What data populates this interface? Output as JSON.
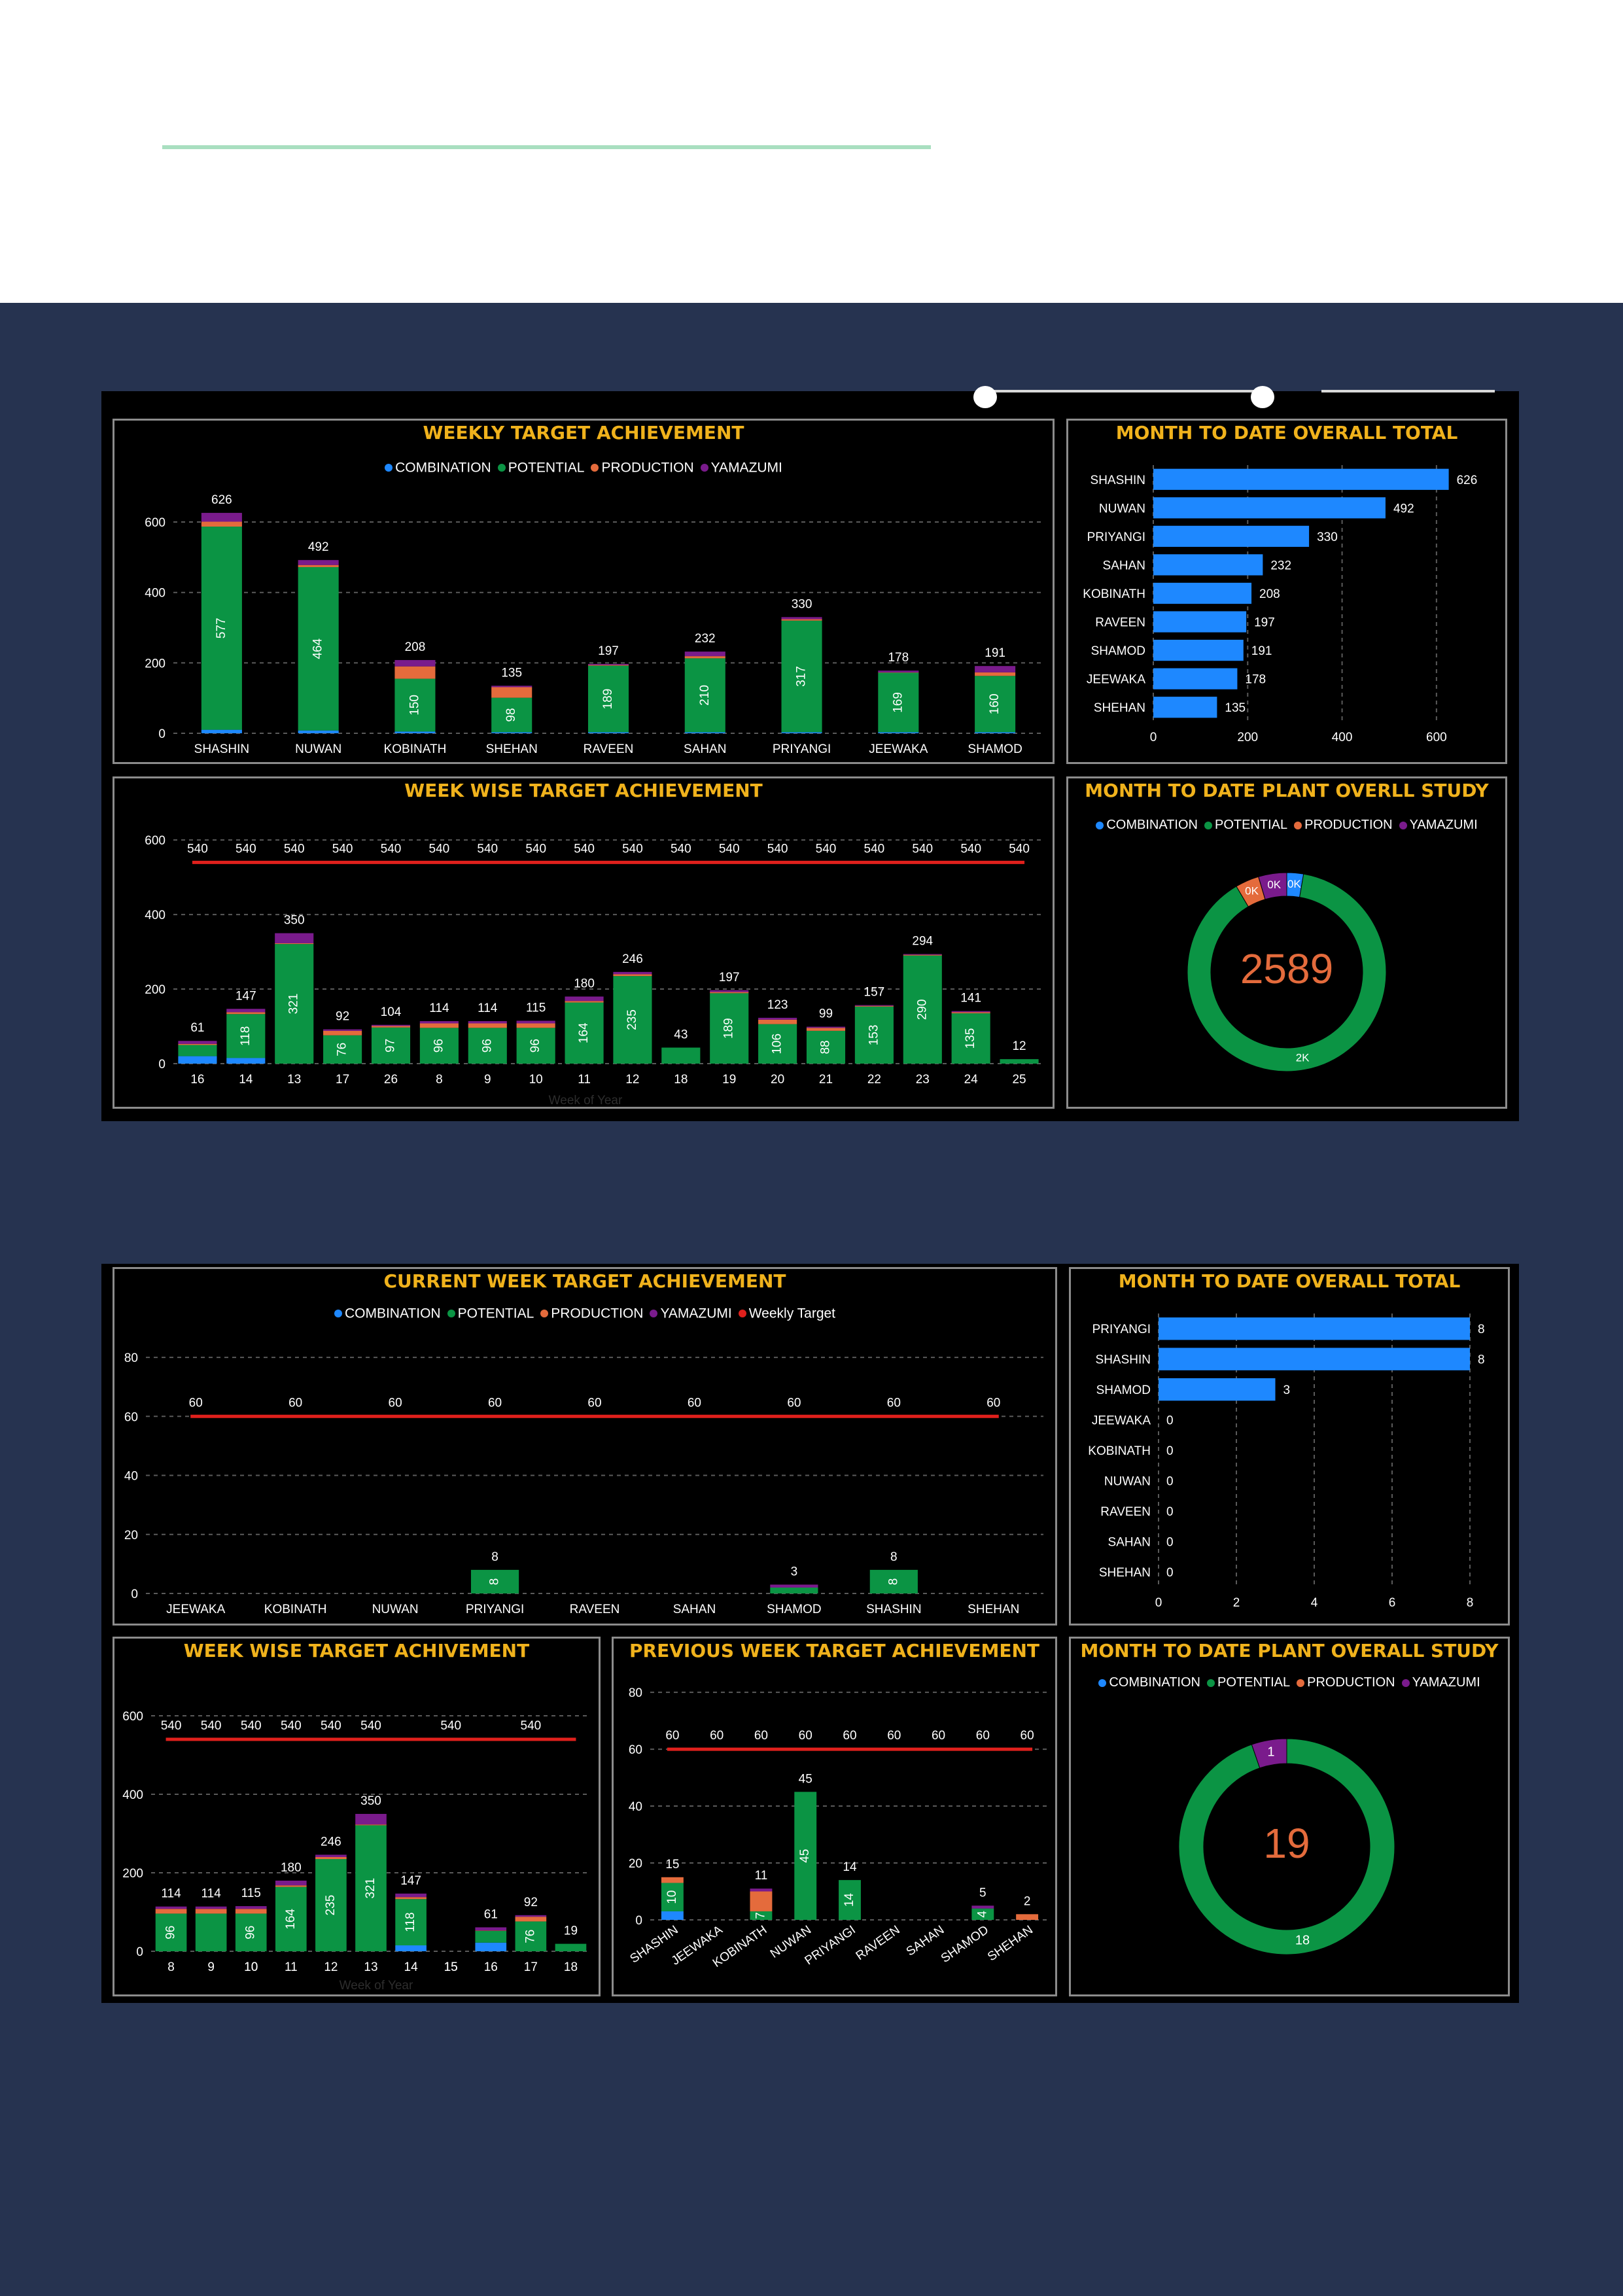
{
  "colors": {
    "combination": "#1e88ff",
    "potential": "#0b9444",
    "production": "#e46b3c",
    "yamazumi": "#7a1b8c",
    "target": "#e0201c",
    "title": "#f0b21c",
    "hbar": "#1e88ff"
  },
  "legend4": [
    "COMBINATION",
    "POTENTIAL",
    "PRODUCTION",
    "YAMAZUMI"
  ],
  "legend5": [
    "COMBINATION",
    "POTENTIAL",
    "PRODUCTION",
    "YAMAZUMI",
    "Weekly Target"
  ],
  "dashboard1": {
    "weekly": {
      "title": "WEEKLY TARGET ACHIEVEMENT",
      "chart_data": {
        "type": "bar",
        "categories": [
          "SHASHIN",
          "NUWAN",
          "KOBINATH",
          "SHEHAN",
          "RAVEEN",
          "SAHAN",
          "PRIYANGI",
          "JEEWAKA",
          "SHAMOD"
        ],
        "series": [
          {
            "name": "COMBINATION",
            "values": [
              10,
              8,
              5,
              3,
              3,
              3,
              3,
              3,
              3
            ]
          },
          {
            "name": "POTENTIAL",
            "values": [
              577,
              464,
              150,
              98,
              189,
              210,
              317,
              169,
              160
            ]
          },
          {
            "name": "PRODUCTION",
            "values": [
              14,
              6,
              35,
              30,
              2,
              6,
              4,
              1,
              10
            ]
          },
          {
            "name": "YAMAZUMI",
            "values": [
              25,
              14,
              18,
              4,
              3,
              13,
              6,
              5,
              18
            ]
          }
        ],
        "inner_labels": [
          "577",
          "464",
          "150",
          "98",
          "189",
          "210",
          "317",
          "169",
          "160"
        ],
        "totals": [
          "626",
          "492",
          "208",
          "135",
          "197",
          "232",
          "330",
          "178",
          "191"
        ],
        "ylim": [
          0,
          680
        ],
        "yticks": [
          0,
          200,
          400,
          600
        ]
      }
    },
    "mtd": {
      "title": "MONTH TO DATE OVERALL TOTAL",
      "chart_data": {
        "type": "bar",
        "categories": [
          "SHASHIN",
          "NUWAN",
          "PRIYANGI",
          "SAHAN",
          "KOBINATH",
          "RAVEEN",
          "SHAMOD",
          "JEEWAKA",
          "SHEHAN"
        ],
        "values": [
          626,
          492,
          330,
          232,
          208,
          197,
          191,
          178,
          135
        ],
        "labels": [
          "626",
          "492",
          "330",
          "232",
          "208",
          "197",
          "191",
          "178",
          "135"
        ],
        "xlim": [
          0,
          700
        ],
        "xticks": [
          0,
          200,
          400,
          600
        ]
      }
    },
    "weekwise": {
      "title": "WEEK WISE TARGET ACHIEVEMENT",
      "xlabel": "Week of Year",
      "chart_data": {
        "type": "bar",
        "categories": [
          "16",
          "14",
          "13",
          "17",
          "26",
          "8",
          "9",
          "10",
          "11",
          "12",
          "18",
          "19",
          "20",
          "21",
          "22",
          "23",
          "24",
          "25"
        ],
        "series": [
          {
            "name": "COMBINATION",
            "values": [
              20,
              15,
              0,
              0,
              0,
              0,
              0,
              0,
              0,
              0,
              0,
              0,
              0,
              0,
              0,
              0,
              0,
              0
            ]
          },
          {
            "name": "POTENTIAL",
            "values": [
              30,
              118,
              321,
              76,
              97,
              96,
              96,
              96,
              164,
              235,
              43,
              189,
              106,
              88,
              153,
              290,
              135,
              12
            ]
          },
          {
            "name": "PRODUCTION",
            "values": [
              3,
              5,
              2,
              12,
              4,
              12,
              12,
              12,
              4,
              5,
              0,
              3,
              12,
              8,
              2,
              2,
              3,
              0
            ]
          },
          {
            "name": "YAMAZUMI",
            "values": [
              8,
              9,
              27,
              4,
              3,
              6,
              6,
              7,
              12,
              6,
              0,
              5,
              5,
              3,
              2,
              2,
              3,
              0
            ]
          }
        ],
        "inner_labels": [
          "",
          "118",
          "321",
          "76",
          "97",
          "96",
          "96",
          "96",
          "164",
          "235",
          "",
          "189",
          "106",
          "88",
          "153",
          "290",
          "135",
          ""
        ],
        "totals": [
          "61",
          "147",
          "350",
          "92",
          "104",
          "114",
          "114",
          "115",
          "180",
          "246",
          "43",
          "197",
          "123",
          "99",
          "157",
          "294",
          "141",
          "12"
        ],
        "target": 540,
        "target_labels": [
          "540",
          "540",
          "540",
          "540",
          "540",
          "540",
          "540",
          "540",
          "540",
          "540",
          "540",
          "540",
          "540",
          "540",
          "540",
          "540",
          "540",
          "540"
        ],
        "ylim": [
          0,
          660
        ],
        "yticks": [
          0,
          200,
          400,
          600
        ]
      }
    },
    "donut": {
      "title": "MONTH TO DATE PLANT OVERLL STUDY",
      "center": "2589",
      "chart_data": {
        "type": "pie",
        "categories": [
          "COMBINATION",
          "POTENTIAL",
          "PRODUCTION",
          "YAMAZUMI"
        ],
        "values": [
          70,
          2300,
          100,
          119
        ],
        "labels": [
          "0K",
          "2K",
          "0K",
          "0K"
        ]
      }
    }
  },
  "dashboard2": {
    "current": {
      "title": "CURRENT WEEK TARGET ACHIEVEMENT",
      "chart_data": {
        "type": "bar",
        "categories": [
          "JEEWAKA",
          "KOBINATH",
          "NUWAN",
          "PRIYANGI",
          "RAVEEN",
          "SAHAN",
          "SHAMOD",
          "SHASHIN",
          "SHEHAN"
        ],
        "series": [
          {
            "name": "COMBINATION",
            "values": [
              0,
              0,
              0,
              0,
              0,
              0,
              0,
              0,
              0
            ]
          },
          {
            "name": "POTENTIAL",
            "values": [
              0,
              0,
              0,
              8,
              0,
              0,
              2,
              8,
              0
            ]
          },
          {
            "name": "PRODUCTION",
            "values": [
              0,
              0,
              0,
              0,
              0,
              0,
              0,
              0,
              0
            ]
          },
          {
            "name": "YAMAZUMI",
            "values": [
              0,
              0,
              0,
              0,
              0,
              0,
              1,
              0,
              0
            ]
          }
        ],
        "inner_labels": [
          "",
          "",
          "",
          "8",
          "",
          "",
          "",
          "8",
          ""
        ],
        "totals": [
          "",
          "",
          "",
          "8",
          "",
          "",
          "3",
          "8",
          ""
        ],
        "target": 60,
        "target_labels": [
          "60",
          "60",
          "60",
          "60",
          "60",
          "60",
          "60",
          "60",
          "60"
        ],
        "ylim": [
          0,
          86
        ],
        "yticks": [
          0,
          20,
          40,
          60,
          80
        ]
      }
    },
    "mtd": {
      "title": "MONTH TO DATE OVERALL TOTAL",
      "chart_data": {
        "type": "bar",
        "categories": [
          "PRIYANGI",
          "SHASHIN",
          "SHAMOD",
          "JEEWAKA",
          "KOBINATH",
          "NUWAN",
          "RAVEEN",
          "SAHAN",
          "SHEHAN"
        ],
        "values": [
          8,
          8,
          3,
          0,
          0,
          0,
          0,
          0,
          0
        ],
        "labels": [
          "8",
          "8",
          "3",
          "0",
          "0",
          "0",
          "0",
          "0",
          "0"
        ],
        "xlim": [
          0,
          8
        ],
        "xticks": [
          0,
          2,
          4,
          6,
          8
        ]
      }
    },
    "weekwise": {
      "title": "WEEK WISE TARGET ACHIVEMENT",
      "xlabel": "Week of Year",
      "chart_data": {
        "type": "bar",
        "categories": [
          "8",
          "9",
          "10",
          "11",
          "12",
          "13",
          "14",
          "15",
          "16",
          "17",
          "18"
        ],
        "series": [
          {
            "name": "COMBINATION",
            "values": [
              0,
              0,
              0,
              0,
              0,
              0,
              15,
              0,
              22,
              0,
              0
            ]
          },
          {
            "name": "POTENTIAL",
            "values": [
              96,
              96,
              96,
              164,
              235,
              321,
              118,
              0,
              30,
              76,
              19
            ]
          },
          {
            "name": "PRODUCTION",
            "values": [
              12,
              12,
              12,
              4,
              5,
              2,
              5,
              0,
              1,
              12,
              0
            ]
          },
          {
            "name": "YAMAZUMI",
            "values": [
              6,
              6,
              7,
              12,
              6,
              27,
              9,
              0,
              8,
              4,
              0
            ]
          }
        ],
        "inner_labels": [
          "96",
          "",
          "96",
          "164",
          "235",
          "321",
          "118",
          "",
          "",
          "76",
          ""
        ],
        "totals": [
          "114",
          "114",
          "115",
          "180",
          "246",
          "350",
          "147",
          "",
          "61",
          "92",
          "19"
        ],
        "below_labels": [
          "",
          "",
          "10",
          "",
          "",
          "",
          "",
          "15",
          "",
          "",
          ""
        ],
        "target": 540,
        "target_labels": [
          "540",
          "540",
          "540",
          "540",
          "540",
          "540",
          "",
          "540",
          "",
          "540"
        ],
        "ylim": [
          0,
          680
        ],
        "yticks": [
          0,
          200,
          400,
          600
        ]
      }
    },
    "previous": {
      "title": "PREVIOUS WEEK TARGET ACHIEVEMENT",
      "chart_data": {
        "type": "bar",
        "categories": [
          "SHASHIN",
          "JEEWAKA",
          "KOBINATH",
          "NUWAN",
          "PRIYANGI",
          "RAVEEN",
          "SAHAN",
          "SHAMOD",
          "SHEHAN"
        ],
        "series": [
          {
            "name": "COMBINATION",
            "values": [
              3,
              0,
              0,
              0,
              0,
              0,
              0,
              0,
              0
            ]
          },
          {
            "name": "POTENTIAL",
            "values": [
              10,
              0,
              3,
              45,
              14,
              0,
              0,
              4,
              0
            ]
          },
          {
            "name": "PRODUCTION",
            "values": [
              2,
              0,
              7,
              0,
              0,
              0,
              0,
              0,
              2
            ]
          },
          {
            "name": "YAMAZUMI",
            "values": [
              0,
              0,
              1,
              0,
              0,
              0,
              0,
              1,
              0
            ]
          }
        ],
        "inner_labels": [
          "10",
          "",
          "7",
          "45",
          "14",
          "",
          "",
          "4",
          ""
        ],
        "totals": [
          "15",
          "",
          "11",
          "45",
          "14",
          "",
          "",
          "5",
          "2"
        ],
        "target": 60,
        "target_labels": [
          "60",
          "60",
          "60",
          "60",
          "60",
          "60",
          "60",
          "60",
          "60"
        ],
        "ylim": [
          0,
          86
        ],
        "yticks": [
          0,
          20,
          40,
          60,
          80
        ]
      }
    },
    "donut": {
      "title": "MONTH TO DATE PLANT OVERALL STUDY",
      "center": "19",
      "chart_data": {
        "type": "pie",
        "categories": [
          "COMBINATION",
          "POTENTIAL",
          "PRODUCTION",
          "YAMAZUMI"
        ],
        "values": [
          0,
          18,
          0,
          1
        ],
        "labels": [
          "",
          "18",
          "",
          "1"
        ]
      }
    }
  }
}
